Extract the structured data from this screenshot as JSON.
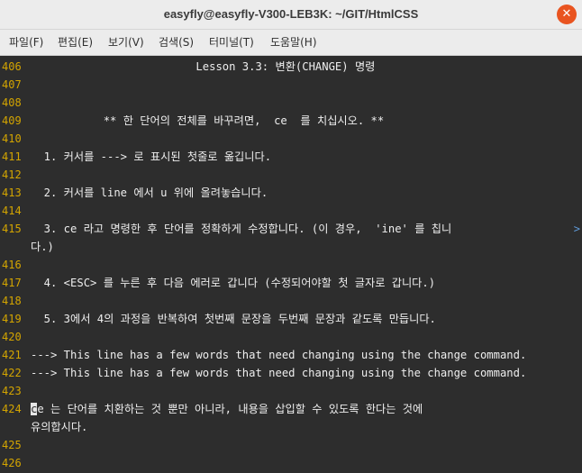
{
  "window": {
    "title": "easyfly@easyfly-V300-LEB3K: ~/GIT/HtmlCSS",
    "close_glyph": "✕"
  },
  "menubar": {
    "items": [
      "파일(F)",
      "편집(E)",
      "보기(V)",
      "검색(S)",
      "터미널(T)",
      "도움말(H)"
    ]
  },
  "editor": {
    "lines": [
      {
        "num": "406",
        "text": "                         Lesson 3.3: 변환(CHANGE) 명령"
      },
      {
        "num": "407",
        "text": ""
      },
      {
        "num": "408",
        "text": ""
      },
      {
        "num": "409",
        "text": "           ** 한 단어의 전체를 바꾸려면,  ce  를 치십시오. **"
      },
      {
        "num": "410",
        "text": ""
      },
      {
        "num": "411",
        "text": "  1. 커서를 ---> 로 표시된 첫줄로 옮깁니다."
      },
      {
        "num": "412",
        "text": ""
      },
      {
        "num": "413",
        "text": "  2. 커서를 line 에서 u 위에 올려놓습니다."
      },
      {
        "num": "414",
        "text": ""
      },
      {
        "num": "415",
        "text": "  3. ce 라고 명령한 후 단어를 정확하게 수정합니다. (이 경우,  'ine' 를 칩니"
      },
      {
        "num": "",
        "text": "다.)"
      },
      {
        "num": "416",
        "text": ""
      },
      {
        "num": "417",
        "text": "  4. <ESC> 를 누른 후 다음 에러로 갑니다 (수정되어야할 첫 글자로 갑니다.)"
      },
      {
        "num": "418",
        "text": ""
      },
      {
        "num": "419",
        "text": "  5. 3에서 4의 과정을 반복하여 첫번째 문장을 두번째 문장과 같도록 만듭니다."
      },
      {
        "num": "420",
        "text": ""
      },
      {
        "num": "421",
        "text": "---> This line has a few words that need changing using the change command."
      },
      {
        "num": "422",
        "text": "---> This line has a few words that need changing using the change command."
      },
      {
        "num": "423",
        "text": ""
      },
      {
        "num": "424",
        "text": "ce 는 단어를 치환하는 것 뿐만 아니라, 내용을 삽입할 수 있도록 한다는 것에"
      },
      {
        "num": "",
        "text": "유의합시다."
      },
      {
        "num": "425",
        "text": ""
      },
      {
        "num": "426",
        "text": ""
      }
    ],
    "wrap_marker": ">",
    "cursor_line_index": 19
  }
}
